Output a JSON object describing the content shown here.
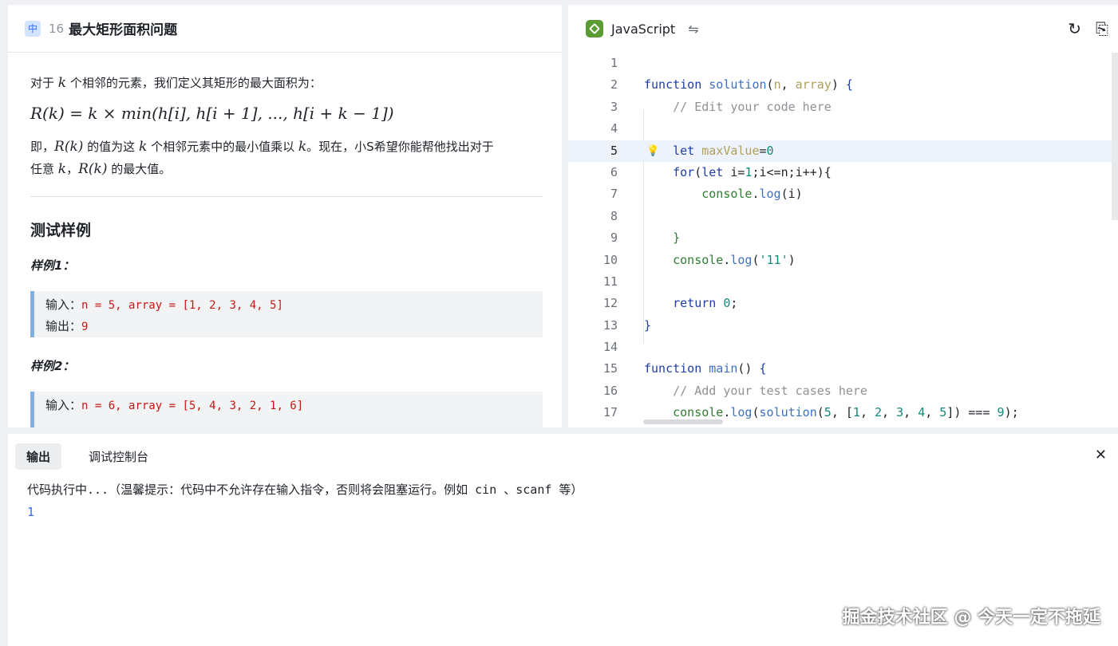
{
  "problem": {
    "difficulty": "中",
    "number": "16",
    "title": "最大矩形面积问题",
    "intro_pre": "对于",
    "intro_var": "k",
    "intro_post": "个相邻的元素，我们定义其矩形的最大面积为：",
    "formula": "R(k) = k × min(h[i], h[i + 1], ..., h[i + k − 1])",
    "desc_line1_a": "即，",
    "desc_rk": "R(k)",
    "desc_line1_b": "的值为这",
    "desc_k": "k",
    "desc_line1_c": "个相邻元素中的最小值乘以",
    "desc_line1_d": "。现在，小S希望你能帮他找出对于",
    "desc_line2_a": "任意",
    "desc_line2_b": "，",
    "desc_line2_c": "的最大值。",
    "section_title": "测试样例",
    "samples": [
      {
        "label": "样例1：",
        "input_label": "输入：",
        "input": "n = 5, array = [1, 2, 3, 4, 5]",
        "output_label": "输出：",
        "output": "9"
      },
      {
        "label": "样例2：",
        "input_label": "输入：",
        "input": "n = 6, array = [5, 4, 3, 2, 1, 6]"
      }
    ]
  },
  "editor": {
    "language": "JavaScript",
    "lines": [
      "1",
      "2",
      "3",
      "4",
      "5",
      "6",
      "7",
      "8",
      "9",
      "10",
      "11",
      "12",
      "13",
      "14",
      "15",
      "16",
      "17"
    ],
    "active_line": 5,
    "accent": "#5a9b32"
  },
  "output_panel": {
    "tabs": [
      "输出",
      "调试控制台"
    ],
    "message": "代码执行中...（温馨提示：代码中不允许存在输入指令，否则将会阻塞运行。例如 cin 、scanf 等）",
    "result": "1"
  },
  "watermark": "掘金技术社区 @ 今天一定不拖延"
}
